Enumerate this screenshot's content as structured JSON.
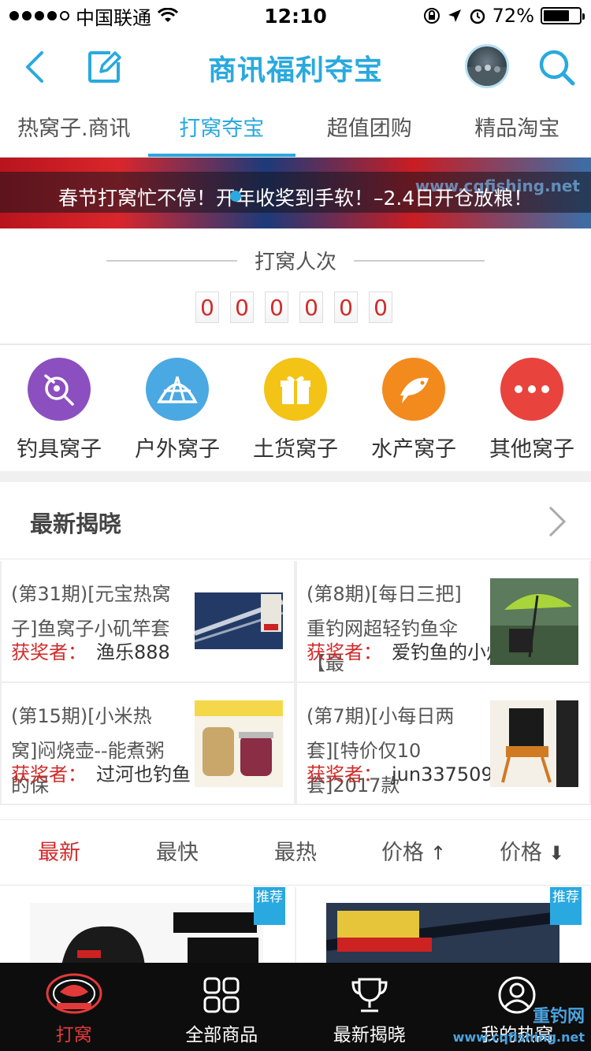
{
  "status_bar": {
    "carrier": "中国联通",
    "time": "12:10",
    "battery": "72%",
    "battery_level": 0.72
  },
  "nav": {
    "title": "商讯福利夺宝"
  },
  "tabs": [
    {
      "label": "热窝子.商讯"
    },
    {
      "label": "打窝夺宝"
    },
    {
      "label": "超值团购"
    },
    {
      "label": "精品淘宝"
    }
  ],
  "banner": {
    "text": "春节打窝忙不停！开年收奖到手软！–2.4日开仓放粮！",
    "watermark": "www.cqfishing.net"
  },
  "counter": {
    "title": "打窝人次",
    "digits": [
      "0",
      "0",
      "0",
      "0",
      "0",
      "0"
    ]
  },
  "categories": [
    {
      "label": "钓具窝子",
      "icon": "fishing-reel-icon",
      "color": "#8c4fbf"
    },
    {
      "label": "户外窝子",
      "icon": "tent-icon",
      "color": "#4aa8e3"
    },
    {
      "label": "土货窝子",
      "icon": "gift-icon",
      "color": "#f3c316"
    },
    {
      "label": "水产窝子",
      "icon": "fish-icon",
      "color": "#f28a1e"
    },
    {
      "label": "其他窝子",
      "icon": "more-dots-icon",
      "color": "#e8433c"
    }
  ],
  "reveals": {
    "title": "最新揭晓",
    "winner_label": "获奖者：",
    "items": [
      {
        "name": "(第31期)[元宝热窝子]鱼窝子小矶竿套",
        "winner": "渔乐888"
      },
      {
        "name": "(第8期)[每日三把]重钓网超轻钓鱼伞【最",
        "winner": "爱钓鱼的小灯毒"
      },
      {
        "name": "(第15期)[小米热窝]闷烧壶--能煮粥的保",
        "winner": "过河也钓鱼"
      },
      {
        "name": "(第7期)[小每日两套][特价仅10套]2017款",
        "winner": "jun33750927"
      }
    ]
  },
  "sort_bar": [
    {
      "label": "最新",
      "arrow": ""
    },
    {
      "label": "最快",
      "arrow": ""
    },
    {
      "label": "最热",
      "arrow": ""
    },
    {
      "label": "价格",
      "arrow": "↑"
    },
    {
      "label": "价格",
      "arrow": "⬇"
    }
  ],
  "products": [
    {
      "badge": "推荐"
    },
    {
      "badge": "推荐"
    }
  ],
  "tab_bar": [
    {
      "label": "打窝",
      "icon": "cqfishing-logo-icon"
    },
    {
      "label": "全部商品",
      "icon": "grid-icon"
    },
    {
      "label": "最新揭晓",
      "icon": "trophy-icon"
    },
    {
      "label": "我的热窝",
      "icon": "user-icon"
    }
  ],
  "tab_bar_watermark": {
    "line1": "重钓网",
    "line2": "www.cqfishing.net"
  },
  "colors": {
    "accent": "#29a9df",
    "red": "#d12b2b",
    "tabbar": "#0d0d0d"
  }
}
